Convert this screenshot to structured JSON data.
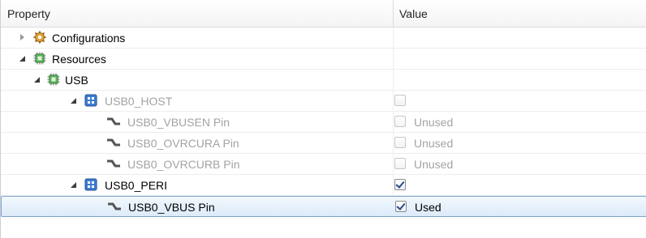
{
  "columns": {
    "property": "Property",
    "value": "Value"
  },
  "rows": [
    {
      "label": "Configurations",
      "icon": "gear-icon",
      "state": "collapsed",
      "value_checked": null,
      "value_label": ""
    },
    {
      "label": "Resources",
      "icon": "chip-icon",
      "state": "expanded",
      "value_checked": null,
      "value_label": ""
    },
    {
      "label": "USB",
      "icon": "chip-icon",
      "state": "expanded",
      "value_checked": null,
      "value_label": ""
    },
    {
      "label": "USB0_HOST",
      "icon": "module-icon",
      "state": "expanded",
      "disabled": true,
      "value_checked": false,
      "value_label": ""
    },
    {
      "label": "USB0_VBUSEN Pin",
      "icon": "pin-icon",
      "disabled": true,
      "value_checked": false,
      "value_label": "Unused"
    },
    {
      "label": "USB0_OVRCURA Pin",
      "icon": "pin-icon",
      "disabled": true,
      "value_checked": false,
      "value_label": "Unused"
    },
    {
      "label": "USB0_OVRCURB Pin",
      "icon": "pin-icon",
      "disabled": true,
      "value_checked": false,
      "value_label": "Unused"
    },
    {
      "label": "USB0_PERI",
      "icon": "module-icon",
      "state": "expanded",
      "value_checked": true,
      "value_label": ""
    },
    {
      "label": "USB0_VBUS Pin",
      "icon": "pin-icon",
      "selected": true,
      "value_checked": true,
      "value_label": "Used"
    }
  ],
  "colors": {
    "selection_border": "#7da2ce",
    "module_icon": "#2f6fbf",
    "chip_icon": "#4aa54a",
    "disabled_text": "#a3a3a3"
  }
}
